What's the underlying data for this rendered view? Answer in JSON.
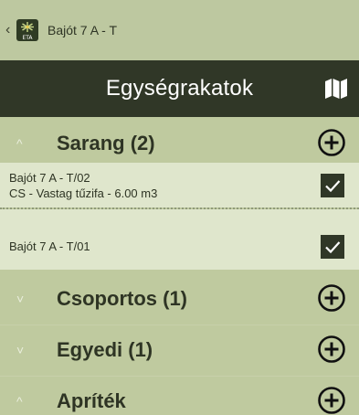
{
  "topbar": {
    "back_icon": "chevron-left-icon",
    "app_icon": "eta-logo-icon",
    "app_icon_text": "ETA",
    "title": "Bajót 7 A - T"
  },
  "header": {
    "title": "Egységrakatok",
    "map_icon": "map-icon"
  },
  "sections": [
    {
      "title": "Sarang (2)",
      "expanded": true,
      "chevron": "^"
    },
    {
      "title": "Csoportos (1)",
      "expanded": false,
      "chevron": "˅"
    },
    {
      "title": "Egyedi (1)",
      "expanded": false,
      "chevron": "˅"
    },
    {
      "title": "Apríték",
      "expanded": true,
      "chevron": "^"
    }
  ],
  "items": [
    {
      "line1": "Bajót 7 A - T/02",
      "line2": "CS - Vastag tűzifa - 6.00 m3",
      "checked": true
    },
    {
      "line1": "Bajót 7 A - T/01",
      "checked": true
    }
  ],
  "colors": {
    "header_bg": "#303727",
    "section_bg": "#bfca9f",
    "item_bg": "#dfe6cc",
    "text": "#2e3424",
    "checkbox_bg": "#303727"
  }
}
